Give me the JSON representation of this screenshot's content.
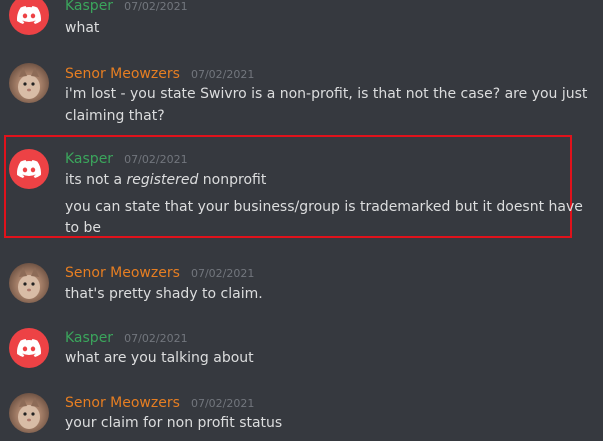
{
  "messages": [
    {
      "author": "Kasper",
      "timestamp": "07/02/2021",
      "lines": [
        "what"
      ]
    },
    {
      "author": "Senor Meowzers",
      "timestamp": "07/02/2021",
      "lines": [
        "i'm lost - you state Swivro is a non-profit, is that not the case? are you just",
        "claiming that?"
      ]
    },
    {
      "author": "Kasper",
      "timestamp": "07/02/2021",
      "line1_pre": "its not a ",
      "line1_em": "registered",
      "line1_post": " nonprofit",
      "lines": [
        "you can state that your business/group is trademarked but it doesnt have",
        "to be"
      ]
    },
    {
      "author": "Senor Meowzers",
      "timestamp": "07/02/2021",
      "lines": [
        "that's pretty shady to claim."
      ]
    },
    {
      "author": "Kasper",
      "timestamp": "07/02/2021",
      "lines": [
        "what are you talking about"
      ]
    },
    {
      "author": "Senor Meowzers",
      "timestamp": "07/02/2021",
      "lines": [
        "your claim for non profit status"
      ]
    }
  ],
  "colors": {
    "background": "#36393f",
    "kasper": "#3ba55c",
    "meowzers": "#e67e22",
    "highlight": "#e0121b"
  }
}
